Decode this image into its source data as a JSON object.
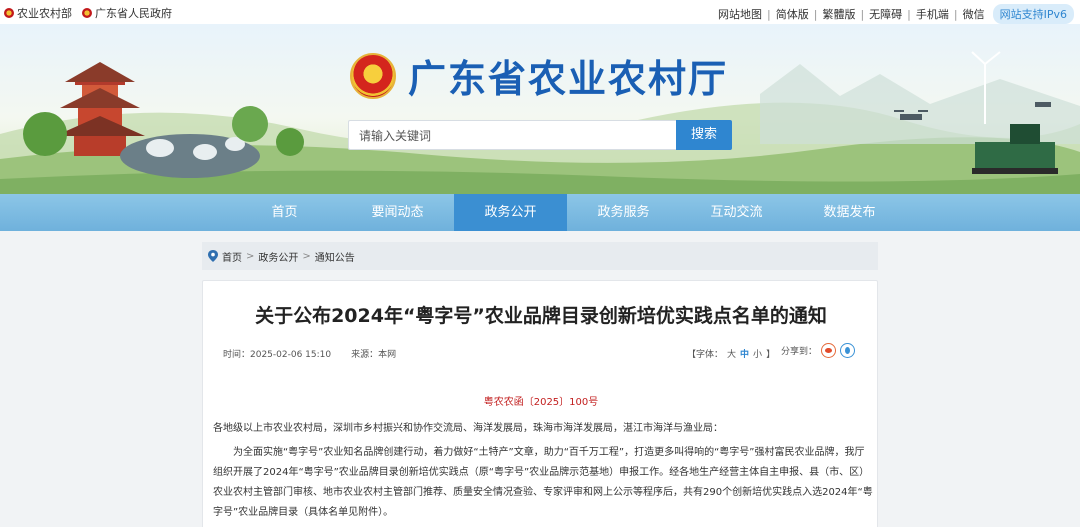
{
  "topbar": {
    "left_links": [
      "农业农村部",
      "广东省人民政府"
    ],
    "right_links": [
      "网站地图",
      "简体版",
      "繁體版",
      "无障碍",
      "手机端",
      "微信"
    ],
    "ipv6_badge": "网站支持IPv6"
  },
  "header": {
    "site_title": "广东省农业农村厅",
    "search_placeholder": "请输入关键词",
    "search_button": "搜索"
  },
  "nav": {
    "items": [
      "首页",
      "要闻动态",
      "政务公开",
      "政务服务",
      "互动交流",
      "数据发布"
    ],
    "active": "政务公开"
  },
  "breadcrumb": [
    "首页",
    "政务公开",
    "通知公告"
  ],
  "article": {
    "title": "关于公布2024年“粤字号”农业品牌目录创新培优实践点名单的通知",
    "time": "时间：2025-02-06 15:10",
    "source": "来源：本网",
    "font_label": "【字体：",
    "font_sizes": [
      "大",
      "中",
      "小"
    ],
    "font_close": "】",
    "share_label": "分享到：",
    "doc_number": "粤农农函〔2025〕100号",
    "addressee": "各地级以上市农业农村局，深圳市乡村振兴和协作交流局、海洋发展局，珠海市海洋发展局，湛江市海洋与渔业局：",
    "paragraph": "为全面实施“粤字号”农业知名品牌创建行动，着力做好“土特产”文章，助力“百千万工程”，打造更多叫得响的“粤字号”强村富民农业品牌，我厅组织开展了2024年“粤字号”农业品牌目录创新培优实践点（原“粤字号”农业品牌示范基地）申报工作。经各地生产经营主体自主申报、县（市、区）农业农村主管部门审核、地市农业农村主管部门推荐、质量安全情况查验、专家评审和网上公示等程序后，共有290个创新培优实践点入选2024年“粤字号”农业品牌目录（具体名单见附件）。"
  },
  "colors": {
    "title_blue": "#1a5fb4",
    "nav_bg": "#7bbbe2",
    "nav_active": "#3b8fd2",
    "doc_number_red": "#c21e1e"
  }
}
